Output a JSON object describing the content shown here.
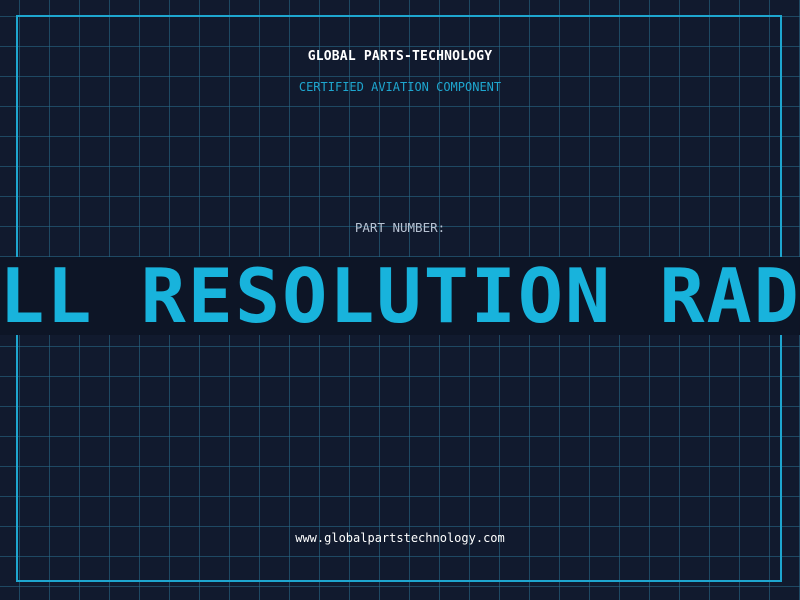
{
  "header": {
    "company": "GLOBAL PARTS-TECHNOLOGY",
    "tagline": "CERTIFIED AVIATION COMPONENT"
  },
  "part": {
    "label": "PART NUMBER:",
    "value": "FULL RESOLUTION RADAR"
  },
  "footer": {
    "url": "www.globalpartstechnology.com"
  },
  "colors": {
    "background": "#111a2e",
    "accent": "#1ea6cf",
    "part_text": "#18b3dc",
    "label_text": "#b7c2d2"
  }
}
